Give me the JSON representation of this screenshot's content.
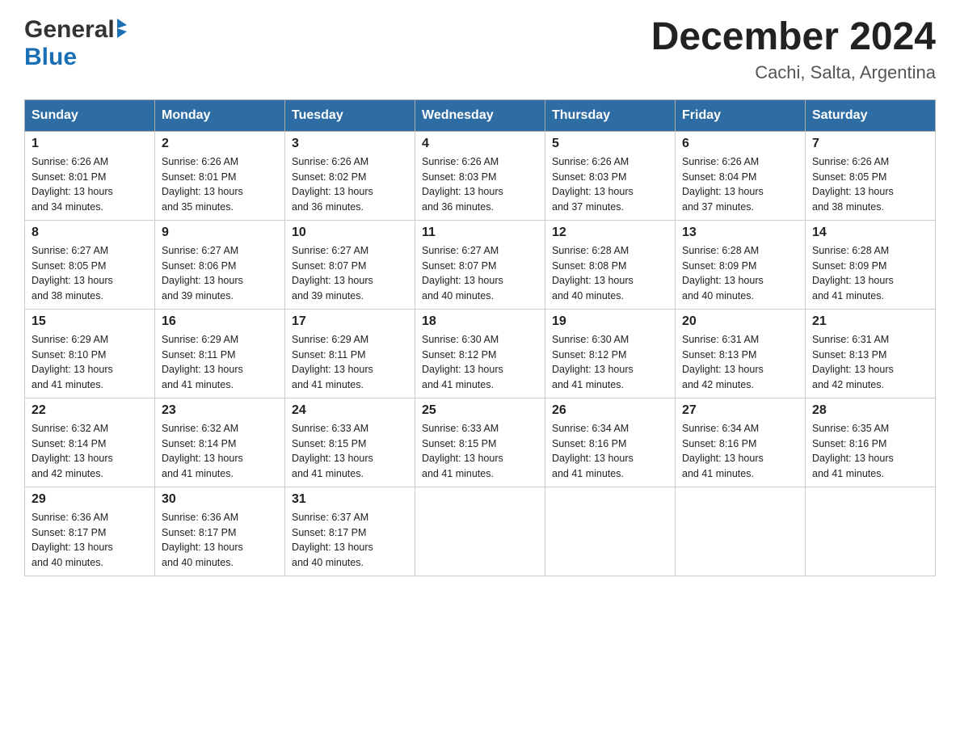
{
  "logo": {
    "general": "General",
    "blue": "Blue"
  },
  "title": {
    "month_year": "December 2024",
    "location": "Cachi, Salta, Argentina"
  },
  "days_of_week": [
    "Sunday",
    "Monday",
    "Tuesday",
    "Wednesday",
    "Thursday",
    "Friday",
    "Saturday"
  ],
  "weeks": [
    [
      {
        "day": "1",
        "sunrise": "6:26 AM",
        "sunset": "8:01 PM",
        "daylight": "13 hours and 34 minutes."
      },
      {
        "day": "2",
        "sunrise": "6:26 AM",
        "sunset": "8:01 PM",
        "daylight": "13 hours and 35 minutes."
      },
      {
        "day": "3",
        "sunrise": "6:26 AM",
        "sunset": "8:02 PM",
        "daylight": "13 hours and 36 minutes."
      },
      {
        "day": "4",
        "sunrise": "6:26 AM",
        "sunset": "8:03 PM",
        "daylight": "13 hours and 36 minutes."
      },
      {
        "day": "5",
        "sunrise": "6:26 AM",
        "sunset": "8:03 PM",
        "daylight": "13 hours and 37 minutes."
      },
      {
        "day": "6",
        "sunrise": "6:26 AM",
        "sunset": "8:04 PM",
        "daylight": "13 hours and 37 minutes."
      },
      {
        "day": "7",
        "sunrise": "6:26 AM",
        "sunset": "8:05 PM",
        "daylight": "13 hours and 38 minutes."
      }
    ],
    [
      {
        "day": "8",
        "sunrise": "6:27 AM",
        "sunset": "8:05 PM",
        "daylight": "13 hours and 38 minutes."
      },
      {
        "day": "9",
        "sunrise": "6:27 AM",
        "sunset": "8:06 PM",
        "daylight": "13 hours and 39 minutes."
      },
      {
        "day": "10",
        "sunrise": "6:27 AM",
        "sunset": "8:07 PM",
        "daylight": "13 hours and 39 minutes."
      },
      {
        "day": "11",
        "sunrise": "6:27 AM",
        "sunset": "8:07 PM",
        "daylight": "13 hours and 40 minutes."
      },
      {
        "day": "12",
        "sunrise": "6:28 AM",
        "sunset": "8:08 PM",
        "daylight": "13 hours and 40 minutes."
      },
      {
        "day": "13",
        "sunrise": "6:28 AM",
        "sunset": "8:09 PM",
        "daylight": "13 hours and 40 minutes."
      },
      {
        "day": "14",
        "sunrise": "6:28 AM",
        "sunset": "8:09 PM",
        "daylight": "13 hours and 41 minutes."
      }
    ],
    [
      {
        "day": "15",
        "sunrise": "6:29 AM",
        "sunset": "8:10 PM",
        "daylight": "13 hours and 41 minutes."
      },
      {
        "day": "16",
        "sunrise": "6:29 AM",
        "sunset": "8:11 PM",
        "daylight": "13 hours and 41 minutes."
      },
      {
        "day": "17",
        "sunrise": "6:29 AM",
        "sunset": "8:11 PM",
        "daylight": "13 hours and 41 minutes."
      },
      {
        "day": "18",
        "sunrise": "6:30 AM",
        "sunset": "8:12 PM",
        "daylight": "13 hours and 41 minutes."
      },
      {
        "day": "19",
        "sunrise": "6:30 AM",
        "sunset": "8:12 PM",
        "daylight": "13 hours and 41 minutes."
      },
      {
        "day": "20",
        "sunrise": "6:31 AM",
        "sunset": "8:13 PM",
        "daylight": "13 hours and 42 minutes."
      },
      {
        "day": "21",
        "sunrise": "6:31 AM",
        "sunset": "8:13 PM",
        "daylight": "13 hours and 42 minutes."
      }
    ],
    [
      {
        "day": "22",
        "sunrise": "6:32 AM",
        "sunset": "8:14 PM",
        "daylight": "13 hours and 42 minutes."
      },
      {
        "day": "23",
        "sunrise": "6:32 AM",
        "sunset": "8:14 PM",
        "daylight": "13 hours and 41 minutes."
      },
      {
        "day": "24",
        "sunrise": "6:33 AM",
        "sunset": "8:15 PM",
        "daylight": "13 hours and 41 minutes."
      },
      {
        "day": "25",
        "sunrise": "6:33 AM",
        "sunset": "8:15 PM",
        "daylight": "13 hours and 41 minutes."
      },
      {
        "day": "26",
        "sunrise": "6:34 AM",
        "sunset": "8:16 PM",
        "daylight": "13 hours and 41 minutes."
      },
      {
        "day": "27",
        "sunrise": "6:34 AM",
        "sunset": "8:16 PM",
        "daylight": "13 hours and 41 minutes."
      },
      {
        "day": "28",
        "sunrise": "6:35 AM",
        "sunset": "8:16 PM",
        "daylight": "13 hours and 41 minutes."
      }
    ],
    [
      {
        "day": "29",
        "sunrise": "6:36 AM",
        "sunset": "8:17 PM",
        "daylight": "13 hours and 40 minutes."
      },
      {
        "day": "30",
        "sunrise": "6:36 AM",
        "sunset": "8:17 PM",
        "daylight": "13 hours and 40 minutes."
      },
      {
        "day": "31",
        "sunrise": "6:37 AM",
        "sunset": "8:17 PM",
        "daylight": "13 hours and 40 minutes."
      },
      null,
      null,
      null,
      null
    ]
  ],
  "labels": {
    "sunrise": "Sunrise:",
    "sunset": "Sunset:",
    "daylight": "Daylight:"
  }
}
